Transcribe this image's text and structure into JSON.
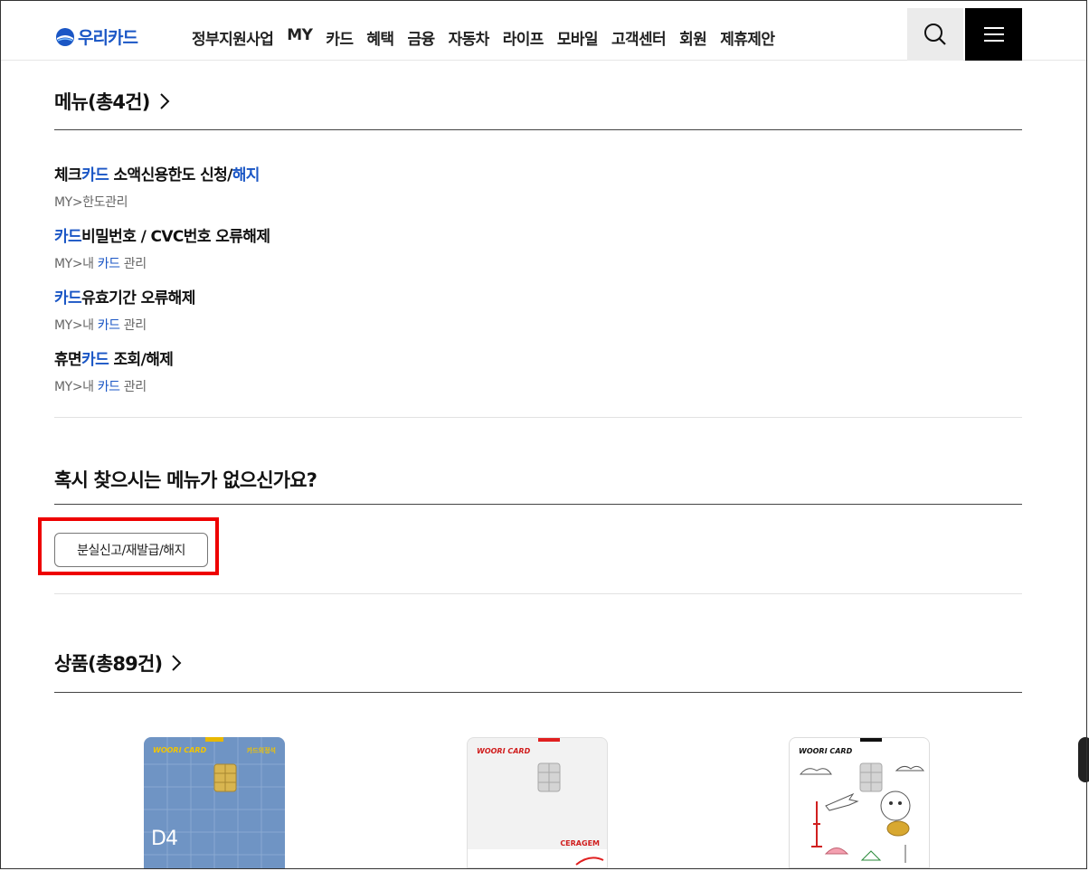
{
  "header": {
    "logo_text": "우리카드",
    "nav": [
      "정부지원사업",
      "MY",
      "카드",
      "혜택",
      "금융",
      "자동차",
      "라이프",
      "모바일",
      "고객센터",
      "회원",
      "제휴제안"
    ]
  },
  "menu_section": {
    "title": "메뉴(총4건)",
    "results": [
      {
        "title_pre": "체크",
        "title_hl": "카드",
        "title_mid": " 소액신용한도 신청/",
        "title_hl2": "해지",
        "path_pre": "MY>한도관리",
        "path_hl": "",
        "path_post": ""
      },
      {
        "title_pre": "",
        "title_hl": "카드",
        "title_mid": "비밀번호 / CVC번호 오류해제",
        "title_hl2": "",
        "path_pre": "MY>내 ",
        "path_hl": "카드",
        "path_post": " 관리"
      },
      {
        "title_pre": "",
        "title_hl": "카드",
        "title_mid": "유효기간 오류해제",
        "title_hl2": "",
        "path_pre": "MY>내 ",
        "path_hl": "카드",
        "path_post": " 관리"
      },
      {
        "title_pre": "휴면",
        "title_hl": "카드",
        "title_mid": " 조회/해제",
        "title_hl2": "",
        "path_pre": "MY>내 ",
        "path_hl": "카드",
        "path_post": " 관리"
      }
    ]
  },
  "suggest_section": {
    "title": "혹시 찾으시는 메뉴가 없으신가요?",
    "chip_label": "분실신고/재발급/해지"
  },
  "product_section": {
    "title": "상품(총89건)",
    "cards": [
      {
        "brand": "WOORI CARD",
        "tag": "카드의정석",
        "mark": "D4",
        "color": "#6f94c4"
      },
      {
        "brand": "WOORI CARD",
        "tag": "",
        "mark": "CERAGEM",
        "color": "#f2f2f2"
      },
      {
        "brand": "WOORI CARD",
        "tag": "",
        "mark": "",
        "color": "#ffffff"
      }
    ]
  },
  "colors": {
    "accent": "#1a56c5",
    "highlight": "#ee0000"
  }
}
